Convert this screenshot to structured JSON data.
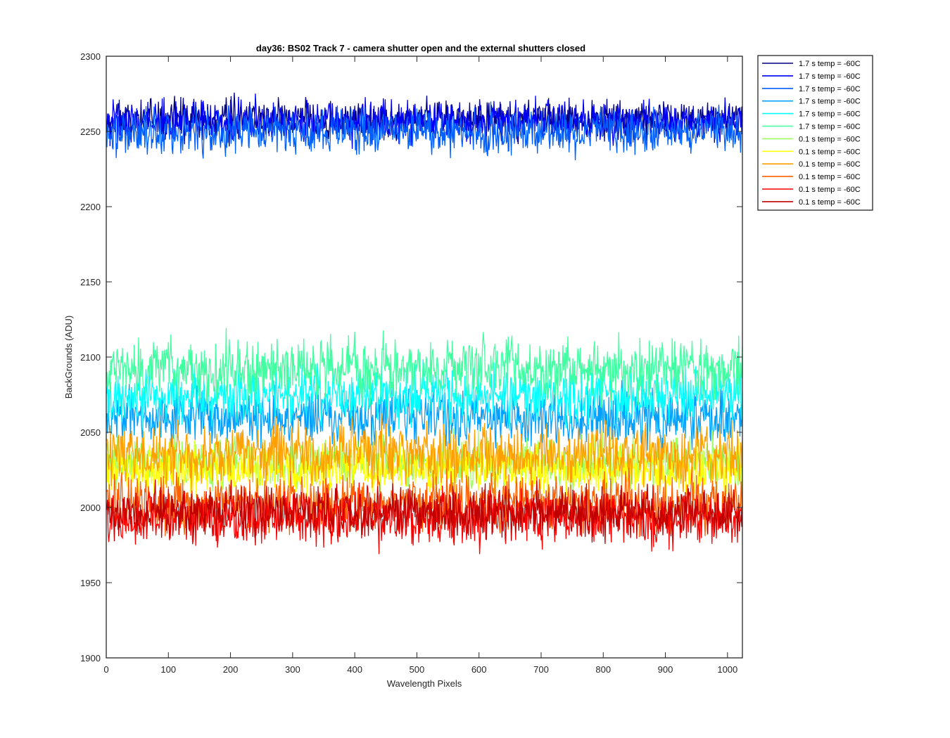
{
  "chart_data": {
    "type": "line",
    "title": "day36: BS02  Track 7 - camera shutter open and the external shutters closed",
    "xlabel": "Wavelength Pixels",
    "ylabel": "BackGrounds (ADU)",
    "xlim": [
      0,
      1024
    ],
    "ylim": [
      1900,
      2300
    ],
    "xticks": [
      0,
      100,
      200,
      300,
      400,
      500,
      600,
      700,
      800,
      900,
      1000
    ],
    "yticks": [
      1900,
      1950,
      2000,
      2050,
      2100,
      2150,
      2200,
      2250,
      2300
    ],
    "grid": false,
    "legend_position": "outside-top-right",
    "n_points": 1024,
    "series": [
      {
        "name": "1.7 s temp = -60C",
        "color": "#000080",
        "mean": 2258,
        "noise": 8,
        "seed": 11
      },
      {
        "name": "1.7 s temp = -60C",
        "color": "#0000ff",
        "mean": 2257,
        "noise": 8,
        "seed": 12
      },
      {
        "name": "1.7 s temp = -60C",
        "color": "#0060ff",
        "mean": 2250,
        "noise": 9,
        "seed": 13
      },
      {
        "name": "1.7 s temp = -60C",
        "color": "#00a0ff",
        "mean": 2060,
        "noise": 11,
        "seed": 14
      },
      {
        "name": "1.7 s temp = -60C",
        "color": "#00ffff",
        "mean": 2075,
        "noise": 11,
        "seed": 15
      },
      {
        "name": "1.7 s temp = -60C",
        "color": "#40ffa0",
        "mean": 2092,
        "noise": 12,
        "seed": 16
      },
      {
        "name": "0.1 s temp = -60C",
        "color": "#a0ff60",
        "mean": 2030,
        "noise": 10,
        "seed": 17
      },
      {
        "name": "0.1 s temp = -60C",
        "color": "#ffff00",
        "mean": 2025,
        "noise": 10,
        "seed": 18
      },
      {
        "name": "0.1 s temp = -60C",
        "color": "#ffa000",
        "mean": 2035,
        "noise": 12,
        "seed": 19
      },
      {
        "name": "0.1 s temp = -60C",
        "color": "#ff6000",
        "mean": 2003,
        "noise": 11,
        "seed": 20
      },
      {
        "name": "0.1 s temp = -60C",
        "color": "#ff0000",
        "mean": 1993,
        "noise": 11,
        "seed": 21
      },
      {
        "name": "0.1 s temp = -60C",
        "color": "#c00000",
        "mean": 1997,
        "noise": 10,
        "seed": 22
      }
    ]
  }
}
